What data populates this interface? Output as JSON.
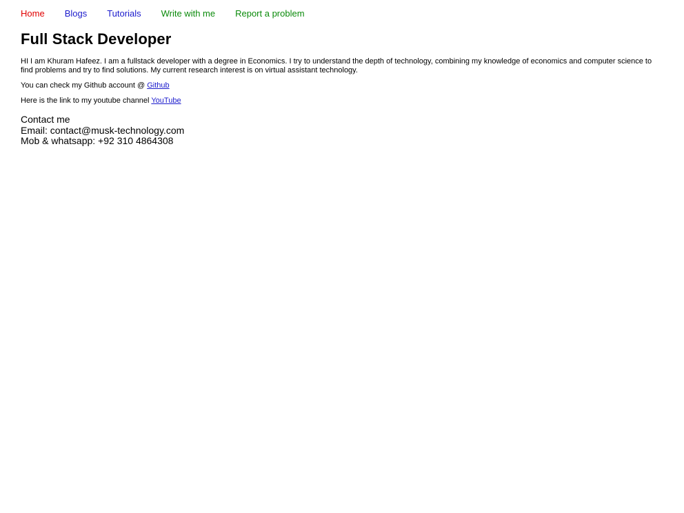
{
  "nav": {
    "home": "Home",
    "blogs": "Blogs",
    "tutorials": "Tutorials",
    "write": "Write with me",
    "report": "Report a problem"
  },
  "colors": {
    "home": "#e00000",
    "links": "#1a1acc",
    "green": "#0a8a0a"
  },
  "title": "Full Stack Developer",
  "intro": "HI I am Khuram Hafeez. I am a fullstack developer with a degree in Economics. I try to understand the depth of technology, combining my knowledge of economics and computer science to find problems and try to find solutions. My current research interest is on virtual assistant technology.",
  "github": {
    "prefix": "You can check my Github account @ ",
    "link_text": "Github"
  },
  "youtube": {
    "prefix": "Here is the link to my youtube channel ",
    "link_text": "YouTube"
  },
  "contact": {
    "heading": "Contact me",
    "email": "Email: contact@musk-technology.com",
    "phone": "Mob & whatsapp: +92 310 4864308"
  }
}
